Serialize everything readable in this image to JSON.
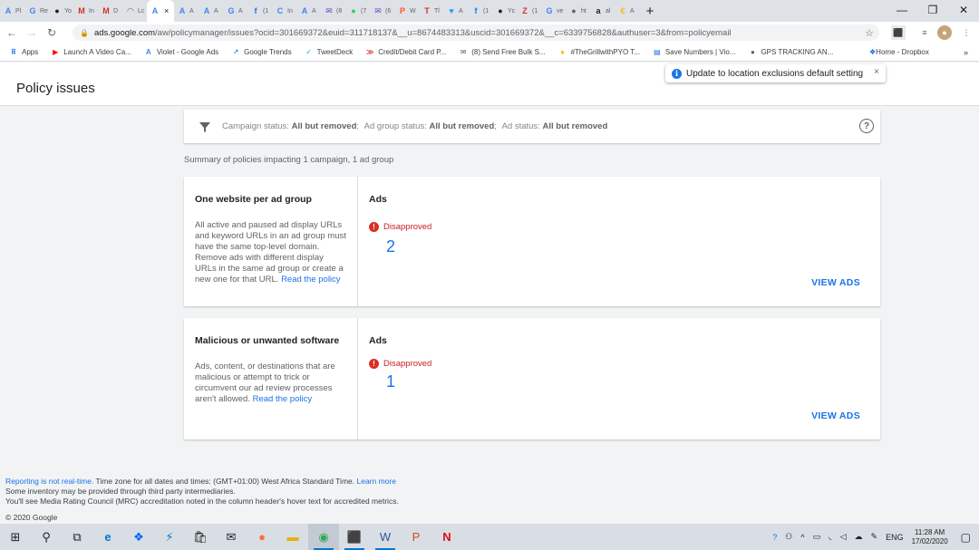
{
  "browser": {
    "tabs": [
      {
        "icon": "google-ads-icon",
        "glyph": "A",
        "color": "#4285f4",
        "label": "Pl"
      },
      {
        "icon": "google-icon",
        "glyph": "G",
        "color": "#4285f4",
        "label": "Re"
      },
      {
        "icon": "app-icon",
        "glyph": "●",
        "color": "#202124",
        "label": "Yo"
      },
      {
        "icon": "gmail-icon",
        "glyph": "M",
        "color": "#d93025",
        "label": "In"
      },
      {
        "icon": "gmail-icon",
        "glyph": "M",
        "color": "#d93025",
        "label": "D"
      },
      {
        "icon": "loading-icon",
        "glyph": "◠",
        "color": "#5f6368",
        "label": "Lc"
      },
      {
        "icon": "google-ads-icon",
        "glyph": "A",
        "color": "#4285f4",
        "label": "",
        "active": true
      },
      {
        "icon": "google-ads-icon",
        "glyph": "A",
        "color": "#4285f4",
        "label": "A"
      },
      {
        "icon": "google-ads-icon",
        "glyph": "A",
        "color": "#4285f4",
        "label": "A"
      },
      {
        "icon": "google-icon",
        "glyph": "G",
        "color": "#4285f4",
        "label": "A"
      },
      {
        "icon": "facebook-icon",
        "glyph": "f",
        "color": "#1877f2",
        "label": "(1"
      },
      {
        "icon": "chrome-web-icon",
        "glyph": "C",
        "color": "#4285f4",
        "label": "In"
      },
      {
        "icon": "google-ads-icon",
        "glyph": "A",
        "color": "#4285f4",
        "label": "A"
      },
      {
        "icon": "mail-icon",
        "glyph": "✉",
        "color": "#6f42c1",
        "label": "(8"
      },
      {
        "icon": "whatsapp-icon",
        "glyph": "●",
        "color": "#25d366",
        "label": "(7"
      },
      {
        "icon": "mail-icon",
        "glyph": "✉",
        "color": "#6f42c1",
        "label": "(6"
      },
      {
        "icon": "app-icon",
        "glyph": "P",
        "color": "#ff5722",
        "label": "W"
      },
      {
        "icon": "app-icon",
        "glyph": "T",
        "color": "#d93025",
        "label": "Tl"
      },
      {
        "icon": "twitter-icon",
        "glyph": "♥",
        "color": "#1da1f2",
        "label": "A"
      },
      {
        "icon": "facebook-icon",
        "glyph": "f",
        "color": "#1877f2",
        "label": "(1"
      },
      {
        "icon": "app-icon",
        "glyph": "●",
        "color": "#202124",
        "label": "Yc"
      },
      {
        "icon": "app-icon",
        "glyph": "Z",
        "color": "#d93025",
        "label": "(1"
      },
      {
        "icon": "google-icon",
        "glyph": "G",
        "color": "#4285f4",
        "label": "ve"
      },
      {
        "icon": "globe-icon",
        "glyph": "●",
        "color": "#5f6368",
        "label": "ht"
      },
      {
        "icon": "amazon-icon",
        "glyph": "a",
        "color": "#202124",
        "label": "al"
      },
      {
        "icon": "app-icon",
        "glyph": "€",
        "color": "#fbbc04",
        "label": "A"
      }
    ],
    "active_tab_close": "×",
    "new_tab": "+",
    "minimize": "—",
    "restore": "❐",
    "close": "✕",
    "url_host": "ads.google.com",
    "url_path": "/aw/policymanager/issues?ocid=301669372&euid=311718137&__u=8674483313&uscid=301669372&__c=6339756828&authuser=3&from=policyemail"
  },
  "bookmarks": [
    {
      "icon": "apps-grid-icon",
      "glyph": "⠿",
      "color": "#1a73e8",
      "label": "Apps"
    },
    {
      "icon": "youtube-icon",
      "glyph": "▶",
      "color": "#ff0000",
      "label": "Launch A Video Ca..."
    },
    {
      "icon": "google-ads-icon",
      "glyph": "A",
      "color": "#4285f4",
      "label": "Violet - Google Ads"
    },
    {
      "icon": "trends-icon",
      "glyph": "↗",
      "color": "#4285f4",
      "label": "Google Trends"
    },
    {
      "icon": "tweetdeck-icon",
      "glyph": "✓",
      "color": "#1da1f2",
      "label": "TweetDeck"
    },
    {
      "icon": "arrow-icon",
      "glyph": "≫",
      "color": "#d93025",
      "label": "Credit/Debit Card P..."
    },
    {
      "icon": "mail-icon",
      "glyph": "✉",
      "color": "#5f6368",
      "label": "(8) Send Free Bulk S..."
    },
    {
      "icon": "app-icon",
      "glyph": "●",
      "color": "#fbbc04",
      "label": "#TheGrillwithPYO T..."
    },
    {
      "icon": "doc-icon",
      "glyph": "▤",
      "color": "#1a73e8",
      "label": "Save Numbers | Vio..."
    },
    {
      "icon": "globe-icon",
      "glyph": "●",
      "color": "#5f6368",
      "label": "GPS TRACKING AN..."
    }
  ],
  "bookmark_right": {
    "icon": "dropbox-icon",
    "glyph": "❖",
    "color": "#0061ff",
    "label": "Home - Dropbox"
  },
  "bookmarks_more": "»",
  "header": {
    "title": "Policy issues",
    "toast": "Update to location exclusions default setting",
    "toast_close": "×"
  },
  "filter": {
    "campaign_label": "Campaign status:",
    "campaign_value": "All but removed",
    "adgroup_label": "Ad group status:",
    "adgroup_value": "All but removed",
    "ad_label": "Ad status:",
    "ad_value": "All but removed",
    "help": "?"
  },
  "summary": "Summary of policies impacting 1 campaign, 1 ad group",
  "policies": [
    {
      "title": "One website per ad group",
      "description": "All active and paused ad display URLs and keyword URLs in an ad group must have the same top-level domain. Remove ads with different display URLs in the same ad group or create a new one for that URL.",
      "link": "Read the policy",
      "column": "Ads",
      "status": "Disapproved",
      "count": "2",
      "action": "VIEW ADS"
    },
    {
      "title": "Malicious or unwanted software",
      "description": "Ads, content, or destinations that are malicious or attempt to trick or circumvent our ad review processes aren't allowed.",
      "link": "Read the policy",
      "column": "Ads",
      "status": "Disapproved",
      "count": "1",
      "action": "VIEW ADS"
    }
  ],
  "footer": {
    "realtime_link": "Reporting is not real-time.",
    "timezone": " Time zone for all dates and times: (GMT+01:00) West Africa Standard Time.",
    "learn_more": "Learn more",
    "line2": "Some inventory may be provided through third party intermediaries.",
    "line3": "You'll see Media Rating Council (MRC) accreditation noted in the column header's hover text for accredited metrics.",
    "copyright": "© 2020 Google"
  },
  "taskbar": {
    "time": "11:28 AM",
    "date": "17/02/2020",
    "lang": "ENG"
  },
  "colors": {
    "accent": "#1a73e8",
    "error": "#d93025"
  }
}
